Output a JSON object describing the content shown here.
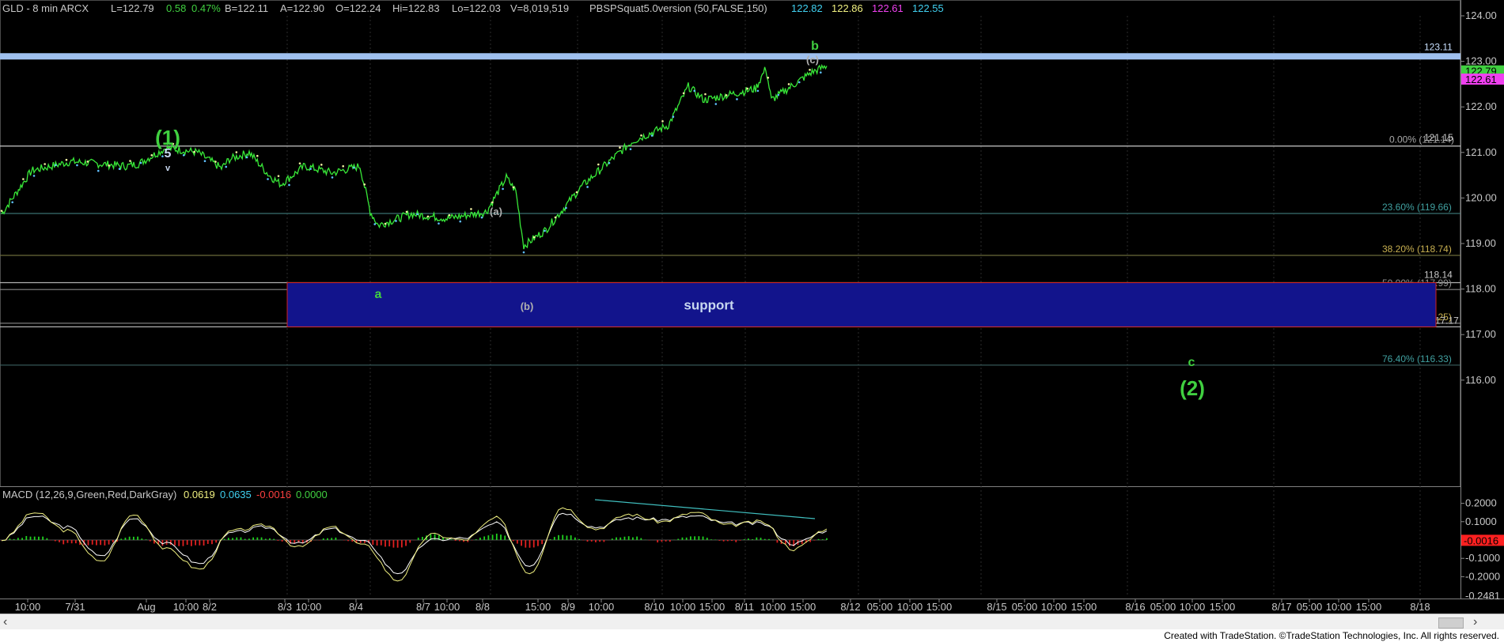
{
  "header": {
    "symbol": "GLD - 8 min  ARCX",
    "last": "L=122.79",
    "change": "0.58",
    "change_pct": "0.47%",
    "bid": "B=122.11",
    "ask": "A=122.90",
    "open": "O=122.24",
    "high": "Hi=122.83",
    "low": "Lo=122.03",
    "volume": "V=8,019,519",
    "study": "PBSPSquat5.0version (50,FALSE,150)",
    "study_vals": [
      "122.82",
      "122.86",
      "122.61",
      "122.55"
    ],
    "study_colors": [
      "#40d0f0",
      "#f0f080",
      "#f040f0",
      "#40d0f0"
    ]
  },
  "macd_header": {
    "label": "MACD (12,26,9,Green,Red,DarkGray)",
    "vals": [
      "0.0619",
      "0.0635",
      "-0.0016",
      "0.0000"
    ],
    "colors": [
      "#f0f080",
      "#40d0f0",
      "#ff4040",
      "#40d040"
    ]
  },
  "chart_data": [
    {
      "type": "line",
      "title": "GLD - 8 min ARCX",
      "ylim": [
        115.3,
        124.3
      ],
      "y_ticks": [
        "124.00",
        "123.00",
        "122.00",
        "121.00",
        "120.00",
        "119.00",
        "118.00",
        "117.00",
        "116.00"
      ],
      "x_ticks": [
        "10:00",
        "7/31",
        "Aug",
        "10:00",
        "8/2",
        "8/3",
        "10:00",
        "8/4",
        "8/7",
        "10:00",
        "8/8",
        "15:00",
        "8/9",
        "10:00",
        "8/10",
        "10:00",
        "15:00",
        "8/11",
        "10:00",
        "15:00",
        "8/12",
        "05:00",
        "10:00",
        "15:00",
        "8/15",
        "05:00",
        "10:00",
        "15:00",
        "8/16",
        "05:00",
        "10:00",
        "15:00",
        "8/17",
        "05:00",
        "10:00",
        "15:00",
        "8/18"
      ],
      "series": [
        {
          "x": [
            "7/28 14:00",
            "7/31 09:30",
            "7/31 12:00",
            "7/31 15:00",
            "8/1 09:30",
            "8/1 10:00",
            "8/1 12:00",
            "8/1 15:00",
            "8/2 09:30",
            "8/2 11:00",
            "8/2 13:00",
            "8/2 15:00",
            "8/3 10:00",
            "8/3 12:00",
            "8/3 15:00",
            "8/4 08:30",
            "8/4 09:00",
            "8/4 12:00",
            "8/7 10:00",
            "8/7 14:00",
            "8/8 09:30",
            "8/8 11:00",
            "8/8 13:00",
            "8/8 14:30",
            "8/8 15:30",
            "8/9 09:30",
            "8/9 12:00",
            "8/9 15:00",
            "8/10 09:00",
            "8/10 10:00",
            "8/10 12:00",
            "8/10 15:00",
            "8/11 09:00",
            "8/11 09:40",
            "8/11 11:00",
            "8/11 13:00",
            "8/11 15:00",
            "8/11 15:55"
          ],
          "values": [
            119.65,
            120.6,
            120.8,
            120.7,
            120.75,
            121.1,
            121.0,
            120.65,
            120.85,
            121.0,
            120.5,
            120.3,
            120.7,
            120.55,
            120.7,
            119.7,
            119.4,
            119.65,
            119.55,
            119.65,
            119.7,
            120.45,
            120.15,
            118.95,
            119.3,
            120.25,
            120.8,
            121.25,
            121.6,
            122.45,
            122.15,
            122.3,
            122.4,
            122.85,
            122.15,
            122.45,
            122.75,
            122.9
          ]
        }
      ],
      "horizontal_levels": [
        {
          "label": "123.11",
          "value": 123.11
        },
        {
          "label": "0.00% (121.14)",
          "value": 121.14
        },
        {
          "label": "121.15",
          "value": 121.15
        },
        {
          "label": "23.60% (119.66)",
          "value": 119.66
        },
        {
          "label": "38.20% (118.74)",
          "value": 118.74
        },
        {
          "label": "118.14",
          "value": 118.14
        },
        {
          "label": "50.00% (117.99)",
          "value": 117.99
        },
        {
          "label": "61.80% (117.25)",
          "value": 117.25
        },
        {
          "label": "117.17",
          "value": 117.17
        },
        {
          "label": "76.40% (116.33)",
          "value": 116.33
        }
      ],
      "price_tags": [
        {
          "value": "122.79",
          "color": "#40d040"
        },
        {
          "value": "122.61",
          "color": "#f040f0"
        }
      ],
      "support_zone": {
        "label": "support",
        "top": 118.14,
        "bottom": 117.17
      },
      "wave_labels": [
        {
          "text": "(1)",
          "color": "#40d040"
        },
        {
          "text": "5",
          "color": "#c8d8f0"
        },
        {
          "text": "v",
          "color": "#c8d8f0"
        },
        {
          "text": "a",
          "color": "#40d040"
        },
        {
          "text": "(a)",
          "color": "#b0b0b0"
        },
        {
          "text": "(b)",
          "color": "#b0b0b0"
        },
        {
          "text": "b",
          "color": "#40d040"
        },
        {
          "text": "(c)",
          "color": "#b0b0b0"
        },
        {
          "text": "c",
          "color": "#40d040"
        },
        {
          "text": "(2)",
          "color": "#40d040"
        }
      ]
    },
    {
      "type": "line",
      "title": "MACD (12,26,9,Green,Red,DarkGray)",
      "ylim": [
        -0.27,
        0.23
      ],
      "y_ticks": [
        "0.2000",
        "0.1000",
        "-0.0016",
        "-0.1000",
        "-0.2000"
      ],
      "y_tick_partial": "-0.2481",
      "series": [
        {
          "name": "MACD",
          "color": "#f0f080",
          "values": [
            0.0,
            0.15,
            0.05,
            -0.12,
            0.14,
            -0.05,
            -0.16,
            0.05,
            0.08,
            -0.04,
            0.07,
            -0.03,
            -0.22,
            0.03,
            0.0,
            0.12,
            -0.18,
            0.18,
            0.06,
            0.14,
            0.1,
            0.15,
            0.08,
            0.1,
            -0.05,
            0.06
          ]
        },
        {
          "name": "Signal",
          "color": "#ffffff",
          "values": [
            0.0,
            0.13,
            0.07,
            -0.09,
            0.12,
            -0.02,
            -0.13,
            0.04,
            0.07,
            -0.02,
            0.06,
            -0.01,
            -0.18,
            0.0,
            0.01,
            0.09,
            -0.14,
            0.15,
            0.07,
            0.12,
            0.11,
            0.13,
            0.09,
            0.09,
            -0.02,
            0.05
          ]
        },
        {
          "name": "MACDAvg diff",
          "color": "#40d040",
          "values": [
            0.0,
            0.02,
            -0.02,
            -0.03,
            0.02,
            -0.03,
            -0.03,
            0.01,
            0.01,
            -0.02,
            0.01,
            -0.02,
            -0.04,
            0.03,
            -0.01,
            0.03,
            -0.04,
            0.03,
            -0.01,
            0.02,
            -0.01,
            0.02,
            -0.01,
            0.01,
            -0.03,
            0.01
          ]
        }
      ],
      "divergence_line": "decreasing"
    }
  ],
  "footer": {
    "credit": "Created with TradeStation. ©TradeStation Technologies, Inc. All rights reserved."
  }
}
